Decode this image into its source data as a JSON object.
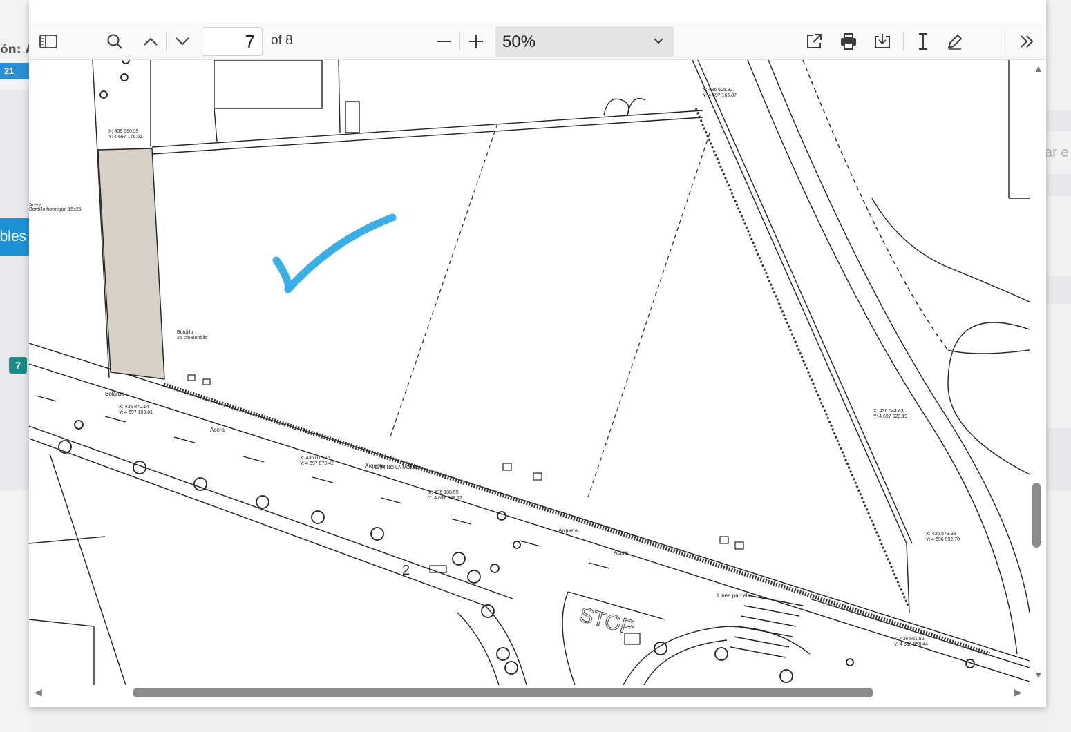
{
  "background": {
    "label_fragment": "ón: A",
    "date_badge": "21",
    "tab_fragment": "bles",
    "count_badge": "7",
    "right_fragment": "ar e"
  },
  "viewer": {
    "toolbar": {
      "current_page": "7",
      "page_count": "of 8",
      "zoom": "50%",
      "icons": [
        "sidebar-toggle-icon",
        "search-icon",
        "chevron-up-icon",
        "chevron-down-icon",
        "minus-icon",
        "plus-icon",
        "open-external-icon",
        "print-icon",
        "download-icon",
        "text-cursor-icon",
        "draw-pen-icon",
        "double-chevron-right-icon"
      ]
    },
    "document": {
      "annotation": "checkmark",
      "annotation_color": "#3aaee5",
      "labels": {
        "stop": "STOP",
        "lane_number": "2",
        "callout_1": "Bolardo",
        "callout_2": "Acera",
        "callout_3": "Arqueta",
        "callout_4": "Arqueta",
        "callout_5": "Acera",
        "callout_6": "Linea parcela"
      }
    }
  },
  "colors": {
    "accent_blue": "#1f92d6",
    "teal": "#1e8a86",
    "zone_fill": "#d9d1c6"
  }
}
